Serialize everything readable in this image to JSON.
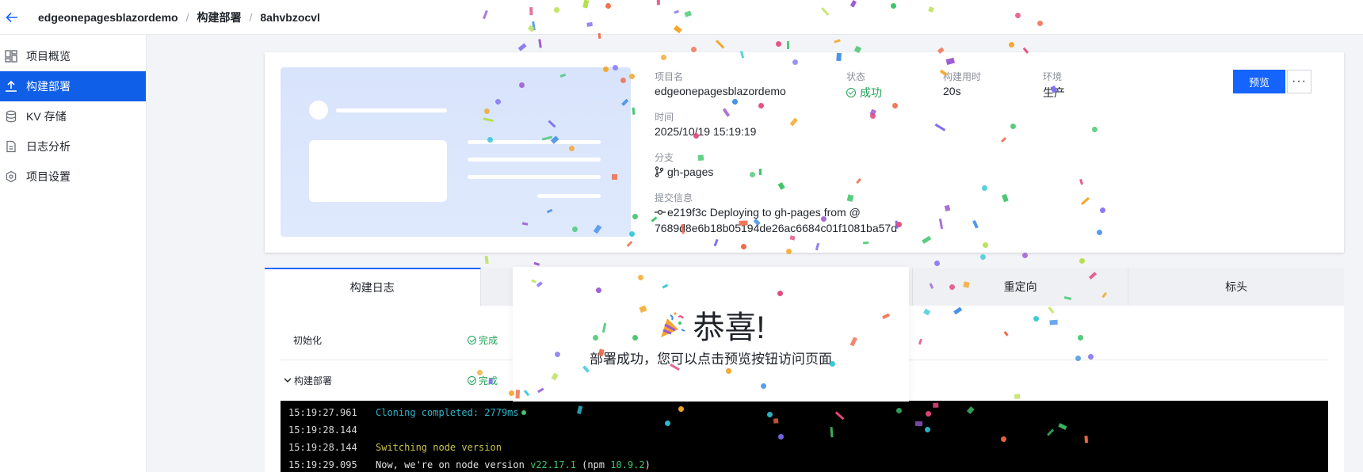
{
  "topbar": {
    "breadcrumb": [
      "edgeonepagesblazordemo",
      "构建部署",
      "8ahvbzocvl"
    ],
    "separator": "/"
  },
  "sidebar": {
    "items": [
      {
        "label": "项目概览",
        "icon": "dashboard-icon",
        "active": false
      },
      {
        "label": "构建部署",
        "icon": "upload-icon",
        "active": true
      },
      {
        "label": "KV 存储",
        "icon": "database-icon",
        "active": false
      },
      {
        "label": "日志分析",
        "icon": "document-icon",
        "active": false
      },
      {
        "label": "项目设置",
        "icon": "settings-icon",
        "active": false
      }
    ]
  },
  "deployment": {
    "project_label": "项目名",
    "project_value": "edgeonepagesblazordemo",
    "status_label": "状态",
    "status_value": "成功",
    "duration_label": "构建用时",
    "duration_value": "20s",
    "env_label": "环境",
    "env_value": "生产",
    "time_label": "时间",
    "time_value": "2025/10/19 15:19:19",
    "branch_label": "分支",
    "branch_value": "gh-pages",
    "commit_label": "提交信息",
    "commit_line1": "e219f3c Deploying to gh-pages from @",
    "commit_line2": "7689d8e6b18b05194de26ac6684c01f1081ba57d",
    "preview_button": "预览",
    "more_button": "···"
  },
  "tabs": [
    {
      "label": "构建日志",
      "active": true
    },
    {
      "label": "",
      "active": false
    },
    {
      "label": "",
      "active": false
    },
    {
      "label": "重定向",
      "active": false
    },
    {
      "label": "标头",
      "active": false
    }
  ],
  "steps": [
    {
      "name": "初始化",
      "status": "完成"
    },
    {
      "name": "构建部署",
      "status": "完成"
    }
  ],
  "terminal": [
    {
      "time": "15:19:27.961",
      "parts": [
        {
          "text": "Cloning completed: 2779ms",
          "color": "cyan"
        }
      ]
    },
    {
      "time": "15:19:28.144",
      "parts": []
    },
    {
      "time": "15:19:28.144",
      "parts": [
        {
          "text": "Switching node version",
          "color": "yellow"
        }
      ]
    },
    {
      "time": "15:19:29.095",
      "parts": [
        {
          "text": "Now, we're on node version ",
          "color": "white"
        },
        {
          "text": "v22.17.1",
          "color": "green"
        },
        {
          "text": " (npm ",
          "color": "white"
        },
        {
          "text": "10.9.2",
          "color": "green"
        },
        {
          "text": ")",
          "color": "white"
        }
      ]
    }
  ],
  "popup": {
    "title": "恭喜!",
    "subtitle": "部署成功，您可以点击预览按钮访问页面",
    "icon": "party-popper-icon"
  },
  "colors": {
    "accent": "#1664ff",
    "sidebar_active": "#0f5fe8",
    "success": "#1fa353",
    "terminal_bg": "#000000"
  }
}
